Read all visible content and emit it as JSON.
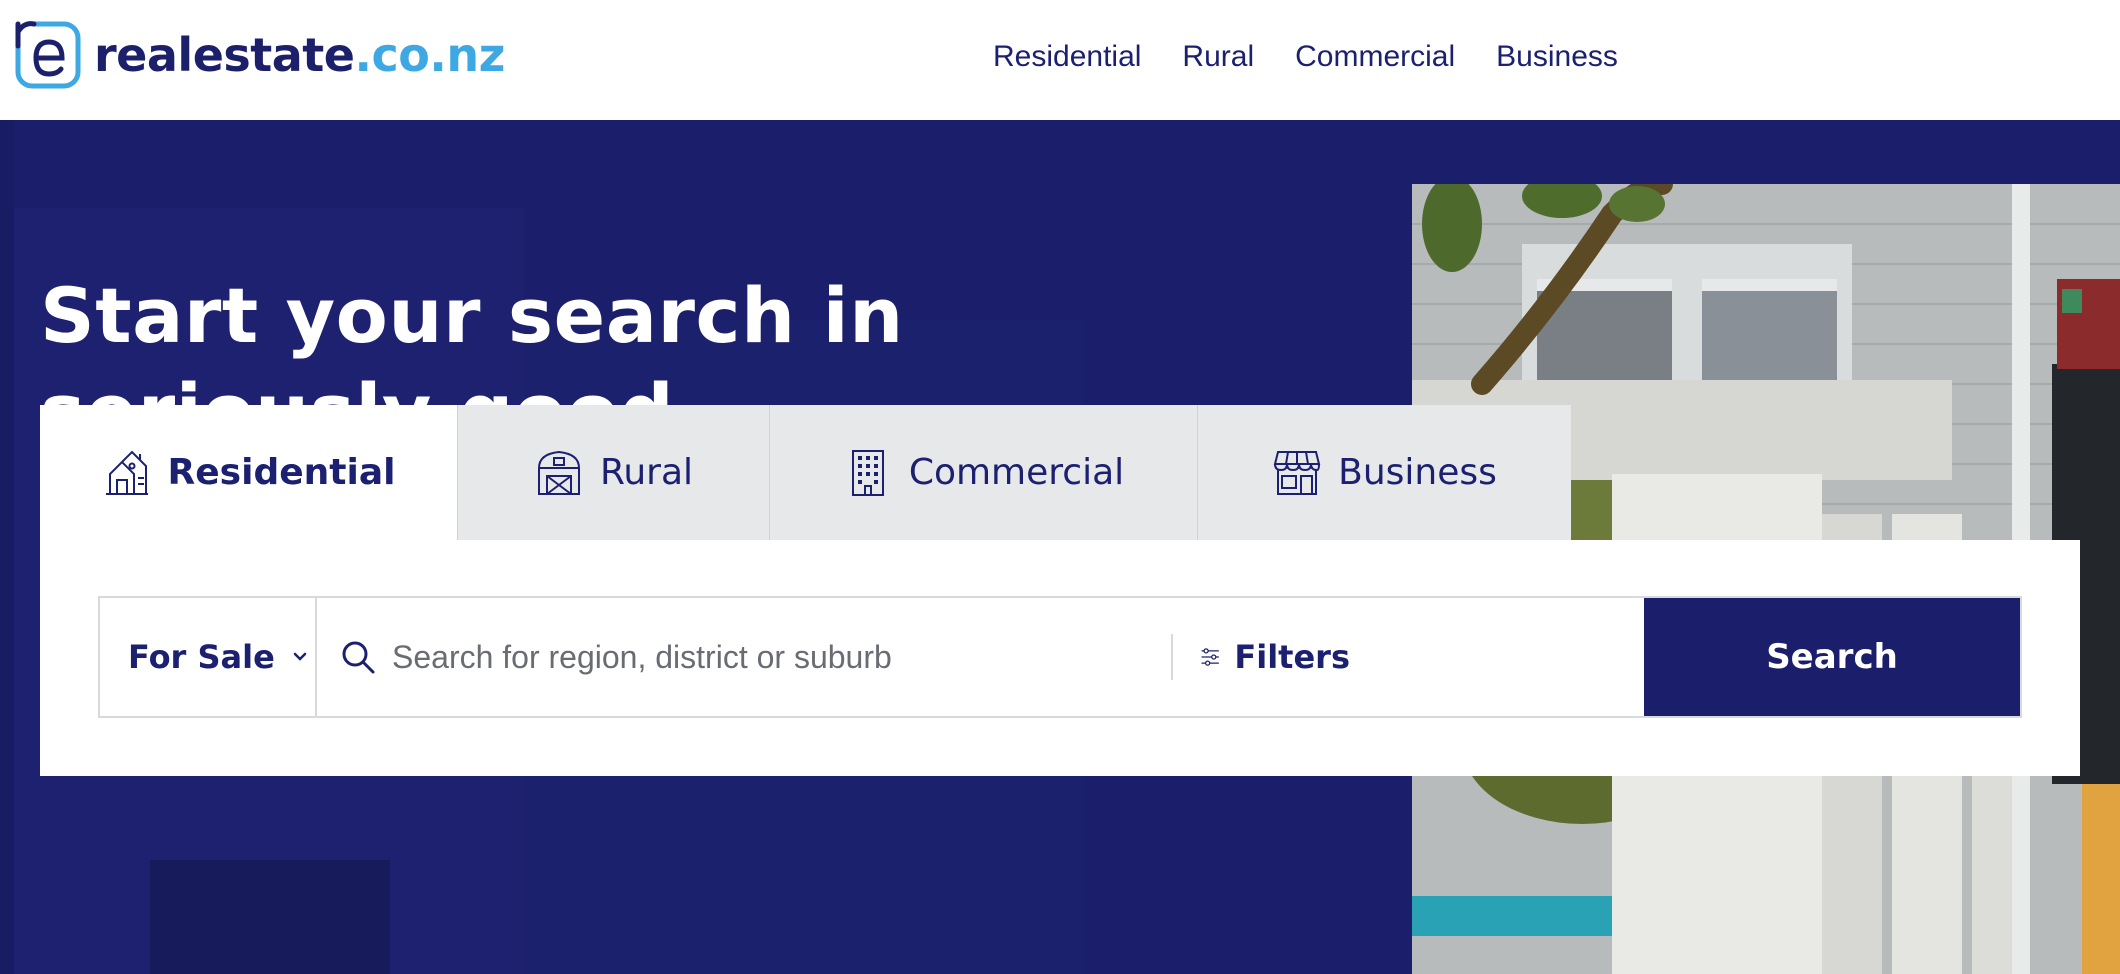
{
  "brand": {
    "name_main": "realestate",
    "name_tld": ".co.nz",
    "primary_color": "#1b1f6b",
    "accent_color": "#3ea8e3"
  },
  "nav": {
    "items": [
      {
        "label": "Residential"
      },
      {
        "label": "Rural"
      },
      {
        "label": "Commercial"
      },
      {
        "label": "Business"
      }
    ]
  },
  "hero": {
    "headline_line1": "Start your search in",
    "headline_line2": "seriously good hands"
  },
  "search": {
    "tabs": [
      {
        "label": "Residential",
        "icon": "house-icon",
        "active": true
      },
      {
        "label": "Rural",
        "icon": "barn-icon",
        "active": false
      },
      {
        "label": "Commercial",
        "icon": "office-building-icon",
        "active": false
      },
      {
        "label": "Business",
        "icon": "storefront-icon",
        "active": false
      }
    ],
    "listing_type": "For Sale",
    "placeholder": "Search for region, district or suburb",
    "filters_label": "Filters",
    "button_label": "Search"
  }
}
